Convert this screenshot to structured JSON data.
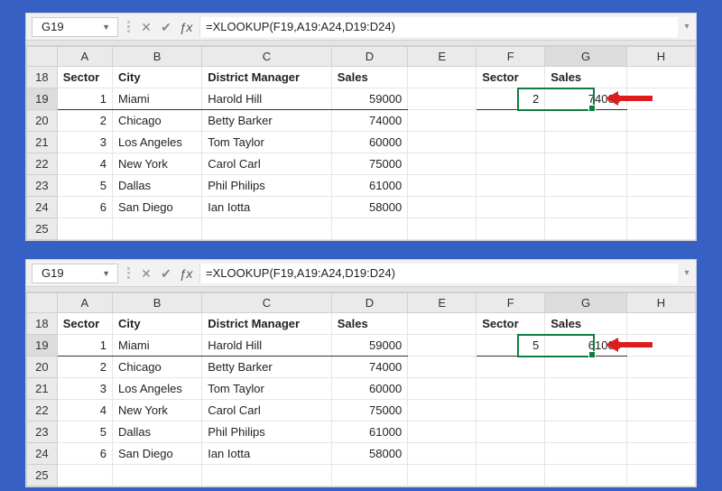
{
  "formula_bar": {
    "cell_ref": "G19",
    "formula": "=XLOOKUP(F19,A19:A24,D19:D24)"
  },
  "columns": [
    "",
    "A",
    "B",
    "C",
    "D",
    "E",
    "F",
    "G",
    "H"
  ],
  "row_numbers": [
    "18",
    "19",
    "20",
    "21",
    "22",
    "23",
    "24",
    "25"
  ],
  "headers": {
    "sector": "Sector",
    "city": "City",
    "district_manager": "District Manager",
    "sales": "Sales"
  },
  "records": [
    {
      "sector": "1",
      "city": "Miami",
      "manager": "Harold Hill",
      "sales": "59000"
    },
    {
      "sector": "2",
      "city": "Chicago",
      "manager": "Betty Barker",
      "sales": "74000"
    },
    {
      "sector": "3",
      "city": "Los Angeles",
      "manager": "Tom Taylor",
      "sales": "60000"
    },
    {
      "sector": "4",
      "city": "New York",
      "manager": "Carol Carl",
      "sales": "75000"
    },
    {
      "sector": "5",
      "city": "Dallas",
      "manager": "Phil Philips",
      "sales": "61000"
    },
    {
      "sector": "6",
      "city": "San Diego",
      "manager": "Ian Iotta",
      "sales": "58000"
    }
  ],
  "panel_top": {
    "lookup_f": "2",
    "lookup_g": "74000"
  },
  "panel_bottom": {
    "lookup_f": "5",
    "lookup_g": "61000"
  }
}
